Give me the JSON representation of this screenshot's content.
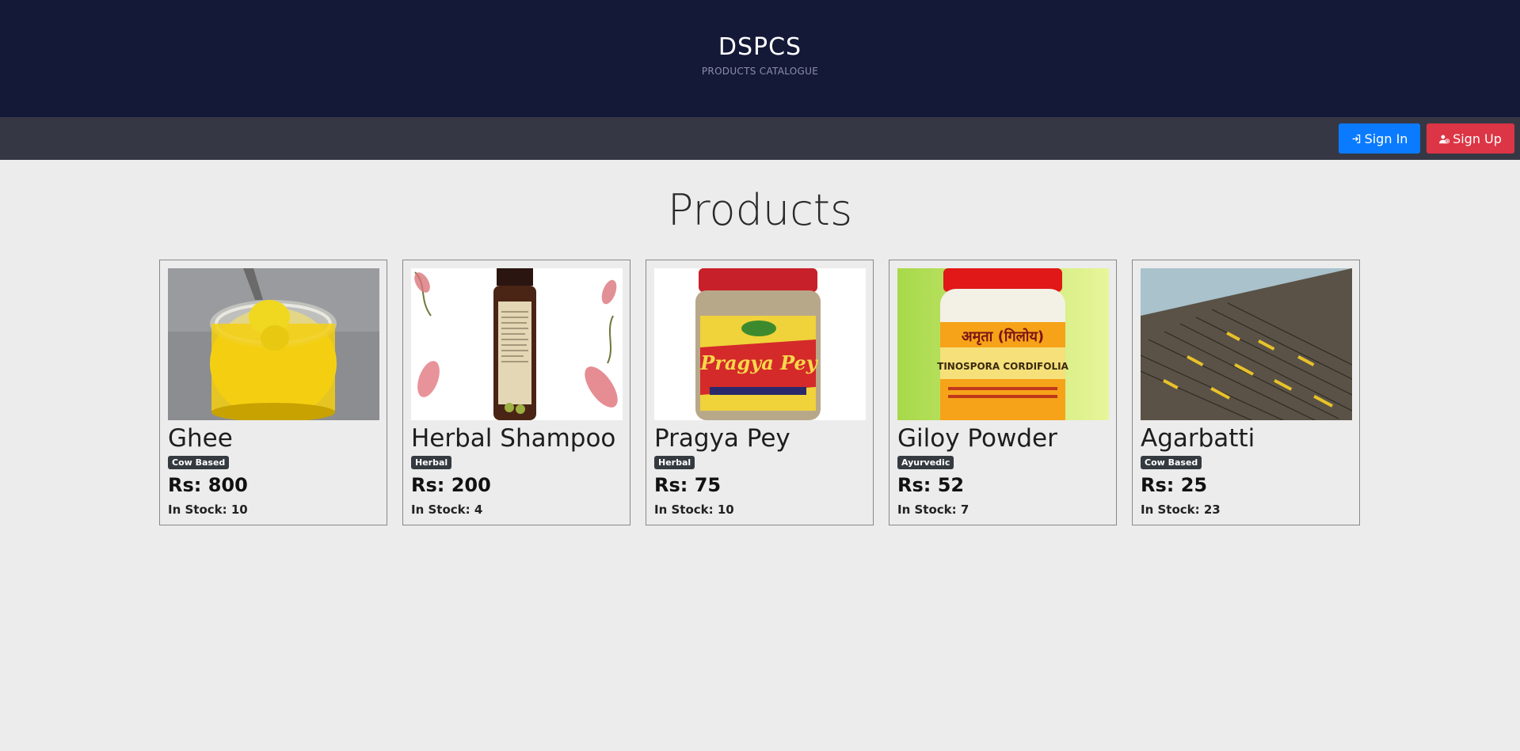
{
  "header": {
    "brand": "DSPCS",
    "tagline": "PRODUCTS CATALOGUE"
  },
  "nav": {
    "signin_label": "Sign In",
    "signup_label": "Sign Up"
  },
  "main": {
    "title": "Products"
  },
  "products": [
    {
      "name": "Ghee",
      "badge": "Cow Based",
      "price": "Rs: 800",
      "stock": "In Stock: 10"
    },
    {
      "name": "Herbal Shampoo",
      "badge": "Herbal",
      "price": "Rs: 200",
      "stock": "In Stock: 4"
    },
    {
      "name": "Pragya Pey",
      "badge": "Herbal",
      "price": "Rs: 75",
      "stock": "In Stock: 10",
      "image_text": "Pragya Pey"
    },
    {
      "name": "Giloy Powder",
      "badge": "Ayurvedic",
      "price": "Rs: 52",
      "stock": "In Stock: 7",
      "image_text": "TINOSPORA CORDIFOLIA"
    },
    {
      "name": "Agarbatti",
      "badge": "Cow Based",
      "price": "Rs: 25",
      "stock": "In Stock: 23"
    }
  ],
  "colors": {
    "header_bg": "#151938",
    "nav_bg": "#353844",
    "signin": "#0a7bff",
    "signup": "#dc3545",
    "badge": "#343a40",
    "page_bg": "#ececec"
  }
}
